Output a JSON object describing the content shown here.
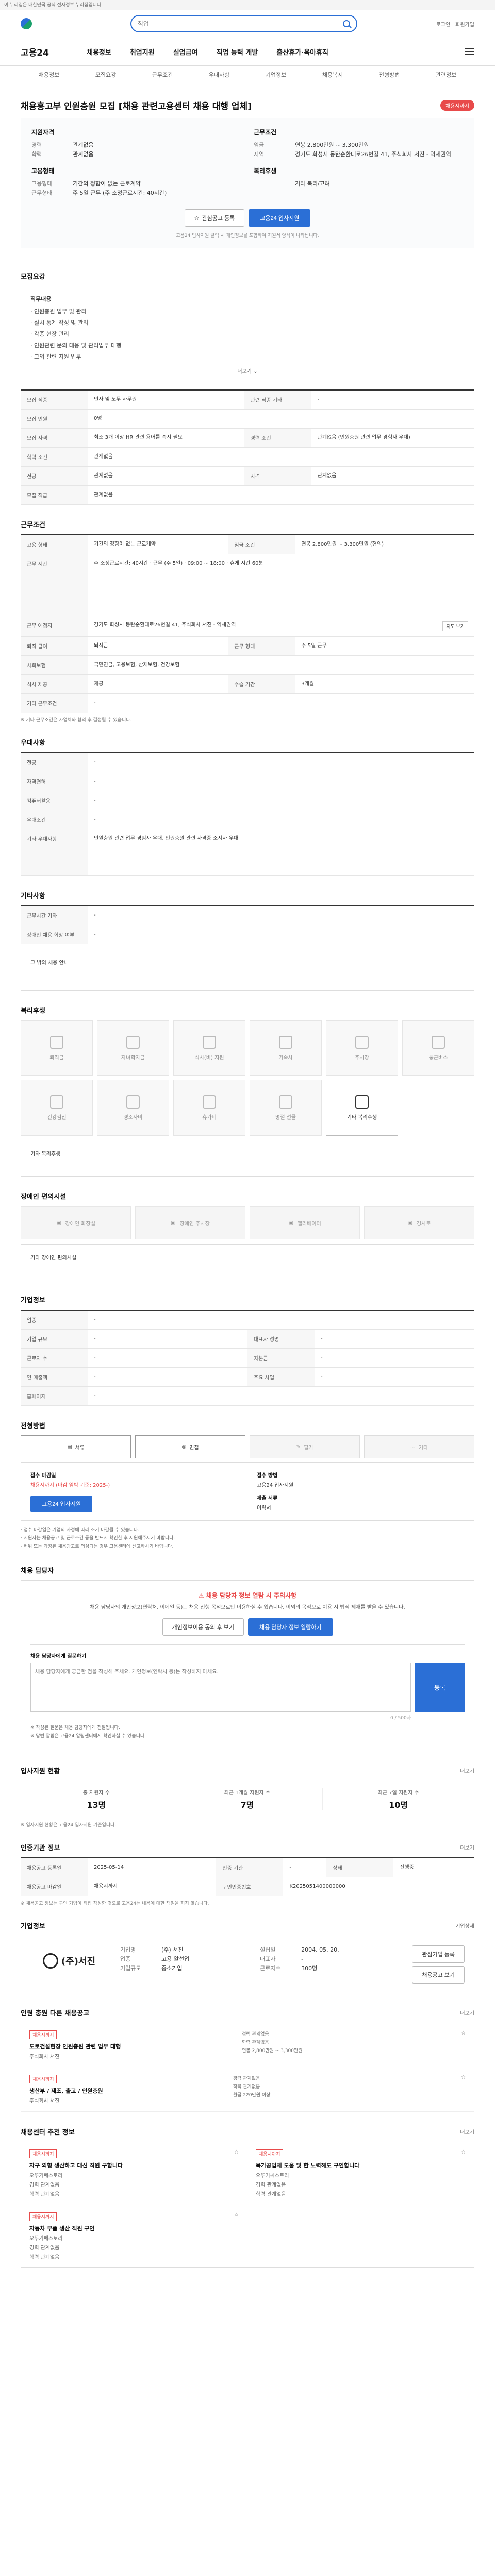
{
  "gov_banner": "이 누리집은 대한민국 공식 전자정부 누리집입니다.",
  "header": {
    "search_placeholder": "직업",
    "util": [
      "로그인",
      "회원가입"
    ],
    "brand": "고용24",
    "gnb": [
      "채용정보",
      "취업지원",
      "실업급여",
      "직업 능력 개발",
      "출산휴가·육아휴직"
    ]
  },
  "tabs": [
    "채용정보",
    "모집요강",
    "근무조건",
    "우대사항",
    "기업정보",
    "채용복지",
    "전형방법",
    "관련정보"
  ],
  "title": {
    "text": "채용홍고부 인원충원 모집 [채용 관련고용센터 채용 대행 업체]",
    "badge": "채용시까지"
  },
  "summary": {
    "left_head": "지원자격",
    "left": [
      {
        "k": "경력",
        "v": "관계없음"
      },
      {
        "k": "학력",
        "v": "관계없음"
      }
    ],
    "left_head2": "고용형태",
    "left2": [
      {
        "k": "고용형태",
        "v": "기간의 정함이 없는 근로계약"
      },
      {
        "k": "근무형태",
        "v": "주 5일 근무 (주 소정근로시간: 40시간)"
      }
    ],
    "right_head": "근무조건",
    "right": [
      {
        "k": "임금",
        "v": "연봉 2,800만원 ~ 3,300만원"
      },
      {
        "k": "지역",
        "v": "경기도 화성시 동탄순환대로26번길 41, 주식회사 서진 - 역세권역"
      }
    ],
    "right_head2": "복리후생",
    "right2": [
      {
        "k": "",
        "v": "기타 복리/고려"
      }
    ],
    "btn_interest": "관심공고 등록",
    "btn_apply": "고용24 입사지원",
    "note": "고용24 입사지원 클릭 시 개인정보를 포함하여 지원서 양식이 나타납니다."
  },
  "recruit": {
    "title": "모집요강",
    "duty_label": "직무내용",
    "bullets": [
      "인원충원 업무 및 관리",
      "실시 통계 작성 및 관리",
      "각종 현장 관리",
      "인원관련 문의 대응 및 관리업무 대행",
      "그외 관련 지원 업무"
    ],
    "fold": "더보기",
    "rows": [
      {
        "k": "모집 직종",
        "v": "인사 및 노무 사무원",
        "k2": "관련 직종 기타",
        "v2": "-"
      },
      {
        "k": "모집 인원",
        "v": "0명",
        "k2": "",
        "v2": ""
      },
      {
        "k": "모집 자격",
        "v": "최소 3개 이상 HR 관련 용어를 숙지 필요",
        "k2": "경력 조건",
        "v2": "관계없음 (인원충원 관련 업무 경험자 우대)"
      },
      {
        "k": "학력 조건",
        "v": "관계없음",
        "k2": "",
        "v2": ""
      },
      {
        "k": "전공",
        "v": "관계없음",
        "k2": "자격",
        "v2": "관계없음"
      },
      {
        "k": "모집 직급",
        "v": "관계없음",
        "k2": "",
        "v2": ""
      }
    ]
  },
  "work": {
    "title": "근무조건",
    "rows": [
      {
        "k": "고용 형태",
        "v": "기간의 정함이 없는 근로계약",
        "k2": "임금 조건",
        "v2": "연봉 2,800만원 ~ 3,300만원 (협의)"
      },
      {
        "k": "근무 시간",
        "v": "주 소정근로시간: 40시간 · 근무 (주 5일) · 09:00 ~ 18:00 · 휴게 시간 60분",
        "k2": "",
        "v2": ""
      },
      {
        "k": "근무 예정지",
        "v": "경기도 화성시 동탄순환대로26번길 41, 주식회사 서진 - 역세권역",
        "k2": "",
        "v2": ""
      },
      {
        "k": "퇴직 급여",
        "v": "퇴직금",
        "k2": "근무 형태",
        "v2": "주 5일 근무"
      },
      {
        "k": "사회보험",
        "v": "국민연금, 고용보험, 산재보험, 건강보험",
        "k2": "",
        "v2": ""
      },
      {
        "k": "식사 제공",
        "v": "제공",
        "k2": "수습 기간",
        "v2": "3개월"
      },
      {
        "k": "기타 근무조건",
        "v": "-",
        "k2": "",
        "v2": ""
      }
    ],
    "map_btn": "지도 보기",
    "note": "※ 기타 근무조건은 사업체와 협의 후 결정될 수 있습니다."
  },
  "pref": {
    "title": "우대사항",
    "rows": [
      {
        "k": "전공",
        "v": "-"
      },
      {
        "k": "자격면허",
        "v": "-"
      },
      {
        "k": "컴퓨터활용",
        "v": "-"
      },
      {
        "k": "우대조건",
        "v": "-"
      },
      {
        "k": "기타 우대사항",
        "v": "인원충원 관련 업무 경험자 우대, 인원충원 관련 자격증 소지자 우대"
      }
    ]
  },
  "etc": {
    "title": "기타사항",
    "rows": [
      {
        "k": "근무시간 기타",
        "v": "-"
      },
      {
        "k": "장애인 채용 희망 여부",
        "v": "-"
      }
    ],
    "link": "그 밖의 채용 안내"
  },
  "welfare": {
    "title": "복리후생",
    "items": [
      {
        "label": "퇴직금",
        "active": false
      },
      {
        "label": "자녀학자금",
        "active": false
      },
      {
        "label": "식사(비) 지원",
        "active": false
      },
      {
        "label": "기숙사",
        "active": false
      },
      {
        "label": "주차장",
        "active": false
      },
      {
        "label": "통근버스",
        "active": false
      },
      {
        "label": "건강검진",
        "active": false
      },
      {
        "label": "경조사비",
        "active": false
      },
      {
        "label": "휴가비",
        "active": false
      },
      {
        "label": "명절 선물",
        "active": false
      },
      {
        "label": "기타 복리후생",
        "active": true
      }
    ],
    "etc_label": "기타 복리후생"
  },
  "care": {
    "title": "장애인 편의시설",
    "items": [
      "장애인 화장실",
      "장애인 주차장",
      "엘리베이터",
      "경사로"
    ],
    "etc_label": "기타 장애인 편의시설"
  },
  "company": {
    "title": "기업정보",
    "rows": [
      {
        "k": "업종",
        "v": "-",
        "k2": "",
        "v2": ""
      },
      {
        "k": "기업 규모",
        "v": "-",
        "k2": "대표자 성명",
        "v2": "-"
      },
      {
        "k": "근로자 수",
        "v": "-",
        "k2": "자본금",
        "v2": "-"
      },
      {
        "k": "연 매출액",
        "v": "-",
        "k2": "주요 사업",
        "v2": "-"
      },
      {
        "k": "홈페이지",
        "v": "-",
        "k2": "",
        "v2": ""
      }
    ]
  },
  "selection": {
    "title": "전형방법",
    "methods": [
      {
        "label": "서류",
        "on": true
      },
      {
        "label": "면접",
        "on": true
      },
      {
        "label": "필기",
        "on": false
      },
      {
        "label": "기타",
        "on": false
      }
    ],
    "apply_head": "접수 마감일",
    "apply_date": "채용시까지 (마감 임박 기준: 2025-)",
    "method_head": "접수 방법",
    "method_val": "고용24 입사지원",
    "docs_head": "제출 서류",
    "docs_val": "이력서",
    "apply_btn": "고용24 입사지원",
    "notes": [
      "· 접수 마감일은 기업의 사정에 따라 조기 마감될 수 있습니다.",
      "· 지원자는 채용공고 및 근로조건 등을 반드시 확인한 후 지원해주시기 바랍니다.",
      "· 허위 또는 과장된 채용광고로 의심되는 경우 고용센터에 신고하시기 바랍니다."
    ]
  },
  "consult": {
    "title": "채용 담당자",
    "warn": "채용 담당자 정보 열람 시 주의사항",
    "desc": "채용 담당자의 개인정보(연락처, 이메일 등)는 채용 진행 목적으로만 이용하실 수 있습니다. 이외의 목적으로 이용 시 법적 제재를 받을 수 있습니다.",
    "btn1": "개인정보이용 동의 후 보기",
    "btn2": "채용 담당자 정보 열람하기",
    "q_label": "채용 담당자에게 질문하기",
    "q_placeholder": "채용 담당자에게 궁금한 점을 작성해 주세요. 개인정보(연락처 등)는 작성하지 마세요.",
    "q_btn": "등록",
    "q_count": "0 / 500자",
    "q_notes": [
      "※ 작성된 질문은 채용 담당자에게 전달됩니다.",
      "※ 답변 알림은 고용24 알림센터에서 확인하실 수 있습니다."
    ]
  },
  "status": {
    "title": "입사지원 현황",
    "more": "더보기",
    "stats": [
      {
        "t": "총 지원자 수",
        "n": "13명"
      },
      {
        "t": "최근 1개월 지원자 수",
        "n": "7명"
      },
      {
        "t": "최근 7일 지원자 수",
        "n": "10명"
      }
    ],
    "note": "※ 입사지원 현황은 고용24 입사지원 기준입니다."
  },
  "manage": {
    "title": "인증기관 정보",
    "more": "더보기",
    "rows": [
      {
        "k": "채용공고 등록일",
        "v": "2025-05-14",
        "k2": "인증 기관",
        "v2": "-",
        "k3": "상태",
        "v3": "진행중"
      },
      {
        "k": "채용공고 마감일",
        "v": "채용시까지",
        "k2": "구인인증번호",
        "v2": "K2025051400000000",
        "k3": "",
        "v3": ""
      }
    ],
    "note": "※ 채용공고 정보는 구인 기업이 직접 작성한 것으로 고용24는 내용에 대한 책임을 지지 않습니다."
  },
  "hirer": {
    "title": "기업정보",
    "more": "기업상세",
    "name": "(주)서진",
    "info": [
      {
        "k": "기업명",
        "v": "(주) 서진"
      },
      {
        "k": "설립일",
        "v": "2004. 05. 20."
      },
      {
        "k": "업종",
        "v": "고용 알선업"
      },
      {
        "k": "대표자",
        "v": "-"
      },
      {
        "k": "기업규모",
        "v": "중소기업"
      },
      {
        "k": "근로자수",
        "v": "300명"
      }
    ],
    "btn1": "관심기업 등록",
    "btn2": "채용공고 보기"
  },
  "related": {
    "title": "인원 충원 다른 채용공고",
    "more": "더보기",
    "cards": [
      {
        "tag": "채용시까지",
        "title": "도로건설현장 인원충원 관련 업무 대행",
        "co": "주식회사 서진",
        "meta": [
          "경력 관계없음",
          "학력 관계없음",
          "연봉 2,800만원 ~ 3,300만원"
        ]
      },
      {
        "tag": "채용시까지",
        "title": "생산부 / 제조, 출고 / 인원충원",
        "co": "주식회사 서진",
        "meta": [
          "경력 관계없음",
          "학력 관계없음",
          "월급 220만원 이상"
        ]
      }
    ]
  },
  "nearby": {
    "title": "채용센터 추천 정보",
    "more": "더보기",
    "cards": [
      {
        "tag": "채용시까지",
        "title": "자구 외형 생산하고 대신 직원 구합니다",
        "co": "오뚜기쎄스토리",
        "meta": [
          "경력 관계없음",
          "학력 관계없음"
        ]
      },
      {
        "tag": "채용시까지",
        "title": "목가공업체 도움 및 한 노력해도 구인합니다",
        "co": "오뚜기쎄스토리",
        "meta": [
          "경력 관계없음",
          "학력 관계없음"
        ]
      },
      {
        "tag": "채용시까지",
        "title": "자동차 부품 생산 직원 구인",
        "co": "오뚜기쎄스토리",
        "meta": [
          "경력 관계없음",
          "학력 관계없음"
        ]
      }
    ]
  },
  "colors": {
    "primary": "#2b6fd6",
    "danger": "#e84a4a"
  }
}
